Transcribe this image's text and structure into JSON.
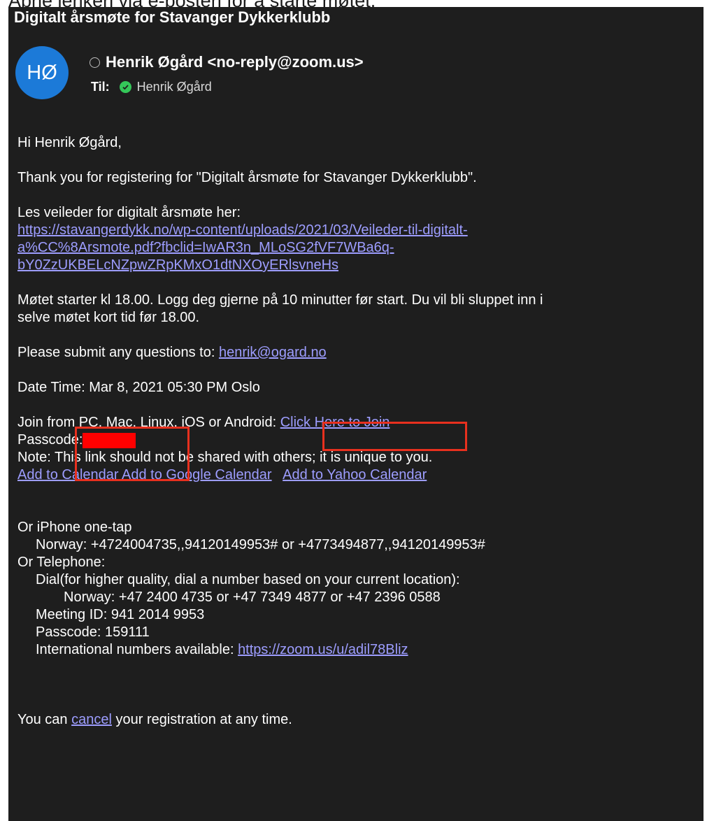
{
  "caption": "Åpne lenken via e-posten for å starte møtet.",
  "email": {
    "subject": "Digitalt årsmøte for Stavanger Dykkerklubb",
    "avatar_initials": "HØ",
    "from": "Henrik Øgård <no-reply@zoom.us>",
    "to_label": "Til:",
    "to_name": "Henrik Øgård",
    "greeting": "Hi Henrik Øgård,",
    "thanks": "Thank you for registering for \"Digitalt årsmøte for Stavanger Dykkerklubb\".",
    "guide_label": "Les veileder for digitalt årsmøte her:",
    "guide_link_line1": "https://stavangerdykk.no/wp-content/uploads/2021/03/Veileder-til-digitalt-",
    "guide_link_line2": "a%CC%8Arsmote.pdf?fbclid=IwAR3n_MLoSG2fVF7WBa6q-",
    "guide_link_line3": "bY0ZzUKBELcNZpwZRpKMxO1dtNXOyERlsvneHs",
    "start_info_line1": "Møtet starter kl 18.00. Logg deg gjerne på 10 minutter før start. Du vil bli sluppet inn i",
    "start_info_line2": "selve møtet kort tid før 18.00.",
    "questions_label": "Please submit any questions to: ",
    "questions_email": "henrik@ogard.no",
    "date_time": "Date Time: Mar 8, 2021 05:30 PM Oslo",
    "join_label": "Join from PC, Mac, Linux, iOS or Android: ",
    "join_link": "Click Here to Join",
    "passcode_label": "Passcode:",
    "note": "Note: This link should not be shared with others; it is unique to you.",
    "calendar_link": "Add to Calendar",
    "google_calendar_link": "Add to Google Calendar",
    "yahoo_calendar_link": "Add to Yahoo Calendar",
    "iphone_title": "Or iPhone one-tap",
    "iphone_norway": "Norway: +4724004735,,94120149953# or +4773494877,,94120149953#",
    "telephone_title": "Or Telephone:",
    "dial_text": "Dial(for higher quality, dial a number based on your current location):",
    "dial_norway": "Norway: +47 2400 4735 or +47 7349 4877 or +47 2396 0588",
    "meeting_id": "Meeting ID: 941 2014 9953",
    "passcode_phone": "Passcode: 159111",
    "intl_label": "International numbers available: ",
    "intl_link": "https://zoom.us/u/adil78Bliz",
    "cancel_prefix": "You can ",
    "cancel_link": "cancel",
    "cancel_suffix": " your registration at any time."
  },
  "colors": {
    "background": "#1e1e1e",
    "link": "#9d9dff",
    "avatar": "#1c7ad8",
    "highlight_box": "#e8301e",
    "redaction": "#ff0000"
  }
}
